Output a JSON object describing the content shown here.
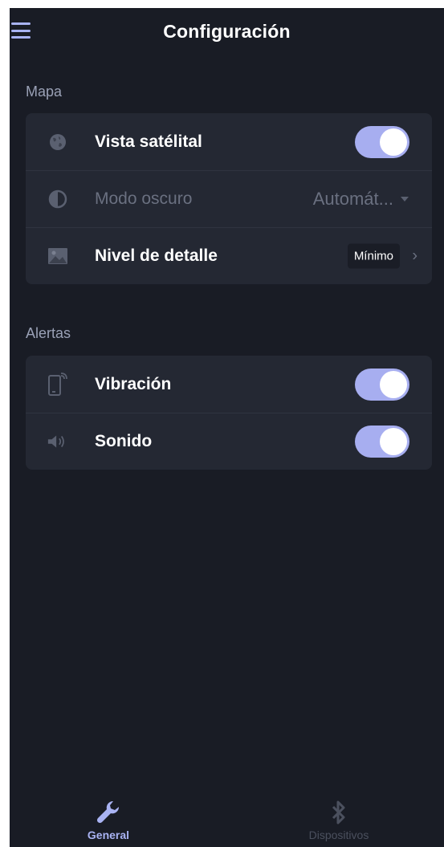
{
  "header": {
    "title": "Configuración",
    "menu_icon": "hamburger-menu-icon"
  },
  "sections": {
    "map": {
      "label": "Mapa",
      "satellite": {
        "label": "Vista satélital",
        "icon": "globe-icon",
        "enabled": true
      },
      "dark_mode": {
        "label": "Modo oscuro",
        "icon": "contrast-icon",
        "value": "Automát...",
        "disabled": true
      },
      "detail": {
        "label": "Nivel de detalle",
        "icon": "image-icon",
        "value": "Mínimo"
      }
    },
    "alerts": {
      "label": "Alertas",
      "vibration": {
        "label": "Vibración",
        "icon": "phone-vibrate-icon",
        "enabled": true
      },
      "sound": {
        "label": "Sonido",
        "icon": "speaker-icon",
        "enabled": true
      }
    }
  },
  "bottom_nav": {
    "general": {
      "label": "General",
      "icon": "wrench-icon",
      "active": true
    },
    "devices": {
      "label": "Dispositivos",
      "icon": "bluetooth-icon",
      "active": false
    }
  },
  "colors": {
    "background": "#191c25",
    "card": "#242833",
    "accent": "#a9b3f3",
    "toggle_on": "#a7aef0"
  }
}
